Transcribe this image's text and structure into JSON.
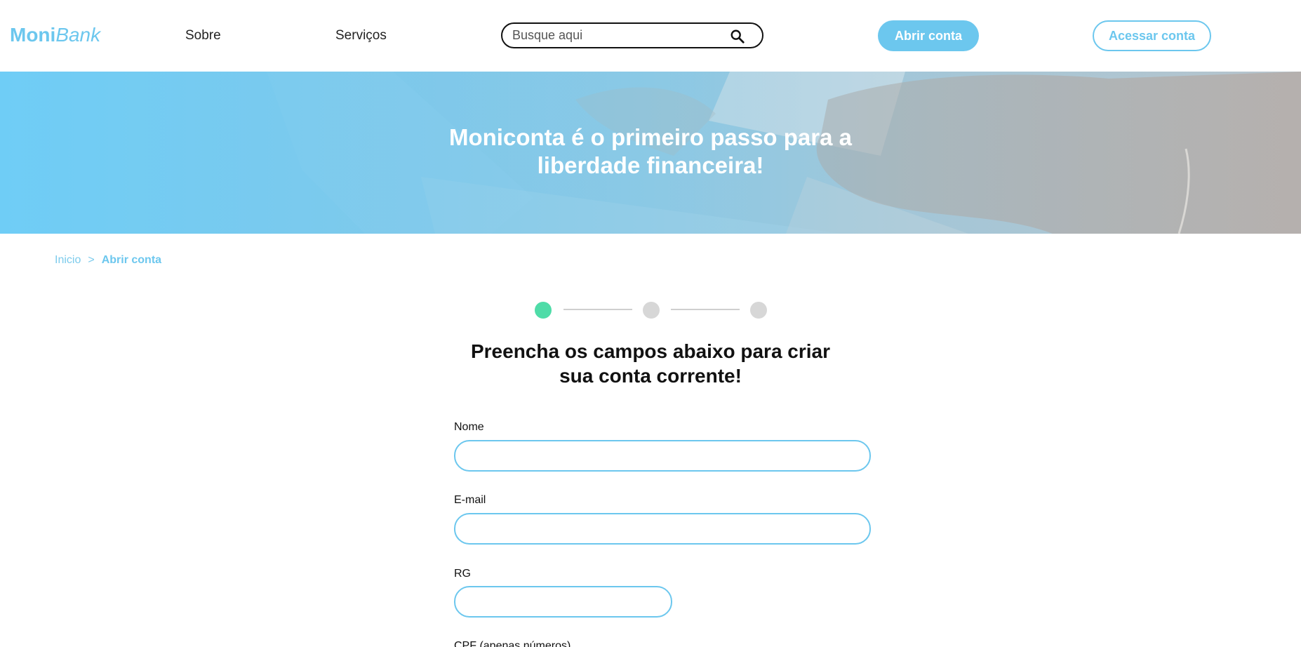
{
  "header": {
    "logo": {
      "moni": "Moni",
      "bank": "Bank"
    },
    "nav": [
      {
        "label": "Sobre"
      },
      {
        "label": "Serviços"
      }
    ],
    "search": {
      "placeholder": "Busque aqui",
      "value": "",
      "icon": "search-icon"
    },
    "open_account_label": "Abrir conta",
    "access_account_label": "Acessar conta"
  },
  "hero": {
    "title_line1": "Moniconta é o primeiro passo para a",
    "title_line2": "liberdade financeira!"
  },
  "breadcrumb": {
    "home": "Inicio",
    "separator": ">",
    "current": "Abrir conta"
  },
  "stepper": {
    "current_step": 1,
    "total_steps": 3
  },
  "form": {
    "title_line1": "Preencha os campos abaixo para criar",
    "title_line2": "sua conta corrente!",
    "fields": [
      {
        "label": "Nome",
        "value": ""
      },
      {
        "label": "E-mail",
        "value": ""
      },
      {
        "label": "RG",
        "value": ""
      },
      {
        "label": "CPF (apenas números)",
        "value": ""
      }
    ]
  },
  "colors": {
    "brand": "#6cc7ee",
    "step_active": "#4fdca8",
    "step_inactive": "#d7d7d7"
  }
}
